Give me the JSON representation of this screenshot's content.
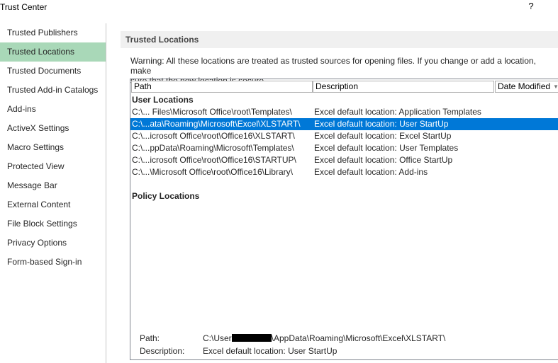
{
  "window": {
    "title": "Trust Center",
    "help_label": "?"
  },
  "sidebar": {
    "items": [
      {
        "label": "Trusted Publishers"
      },
      {
        "label": "Trusted Locations"
      },
      {
        "label": "Trusted Documents"
      },
      {
        "label": "Trusted Add-in Catalogs"
      },
      {
        "label": "Add-ins"
      },
      {
        "label": "ActiveX Settings"
      },
      {
        "label": "Macro Settings"
      },
      {
        "label": "Protected View"
      },
      {
        "label": "Message Bar"
      },
      {
        "label": "External Content"
      },
      {
        "label": "File Block Settings"
      },
      {
        "label": "Privacy Options"
      },
      {
        "label": "Form-based Sign-in"
      }
    ],
    "selected": "Trusted Locations"
  },
  "main": {
    "section_title": "Trusted Locations",
    "warning_line1": "Warning: All these locations are treated as trusted sources for opening files.  If you change or add a location, make",
    "warning_line2": "sure that the new location is secure.",
    "columns": {
      "path": "Path",
      "description": "Description",
      "date_modified": "Date Modified"
    },
    "user_locations_label": "User Locations",
    "user_locations": [
      {
        "path": "C:\\... Files\\Microsoft Office\\root\\Templates\\",
        "description": "Excel default location: Application Templates"
      },
      {
        "path": "C:\\...ata\\Roaming\\Microsoft\\Excel\\XLSTART\\",
        "description": "Excel default location: User StartUp",
        "selected": true
      },
      {
        "path": "C:\\...icrosoft Office\\root\\Office16\\XLSTART\\",
        "description": "Excel default location: Excel StartUp"
      },
      {
        "path": "C:\\...ppData\\Roaming\\Microsoft\\Templates\\",
        "description": "Excel default location: User Templates"
      },
      {
        "path": "C:\\...icrosoft Office\\root\\Office16\\STARTUP\\",
        "description": "Excel default location: Office StartUp"
      },
      {
        "path": "C:\\...\\Microsoft Office\\root\\Office16\\Library\\",
        "description": "Excel default location: Add-ins"
      }
    ],
    "policy_locations_label": "Policy Locations",
    "details": {
      "path_label": "Path:",
      "path_prefix": "C:\\User",
      "path_suffix": "\\AppData\\Roaming\\Microsoft\\Excel\\XLSTART\\",
      "description_label": "Description:",
      "description_value": "Excel default location: User StartUp"
    }
  },
  "colors": {
    "sidebar_selected": "#a9d8b8",
    "row_selected": "#0078d7",
    "section_header_bg": "#f0f0f0"
  }
}
